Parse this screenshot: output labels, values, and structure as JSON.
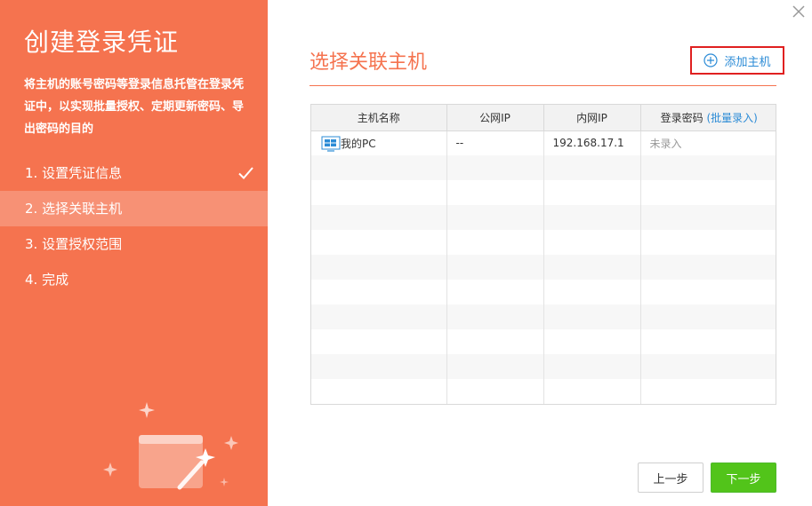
{
  "sidebar": {
    "title": "创建登录凭证",
    "description": "将主机的账号密码等登录信息托管在登录凭证中，以实现批量授权、定期更新密码、导出密码的目的",
    "steps": [
      {
        "label": "1. 设置凭证信息",
        "state": "done"
      },
      {
        "label": "2. 选择关联主机",
        "state": "active"
      },
      {
        "label": "3. 设置授权范围",
        "state": "pending"
      },
      {
        "label": "4. 完成",
        "state": "pending"
      }
    ]
  },
  "main": {
    "title": "选择关联主机",
    "add_host_label": "添加主机"
  },
  "table": {
    "headers": {
      "host_name": "主机名称",
      "public_ip": "公网IP",
      "private_ip": "内网IP",
      "login_password": "登录密码",
      "batch_entry": "(批量录入)"
    },
    "rows": [
      {
        "host_name": "我的PC",
        "public_ip": "--",
        "private_ip": "192.168.17.1",
        "login_password": "未录入"
      }
    ]
  },
  "footer": {
    "prev_label": "上一步",
    "next_label": "下一步"
  },
  "colors": {
    "accent": "#f5734f",
    "link": "#2b8bd6",
    "primary_button": "#52c41a",
    "highlight_border": "#e02020"
  }
}
